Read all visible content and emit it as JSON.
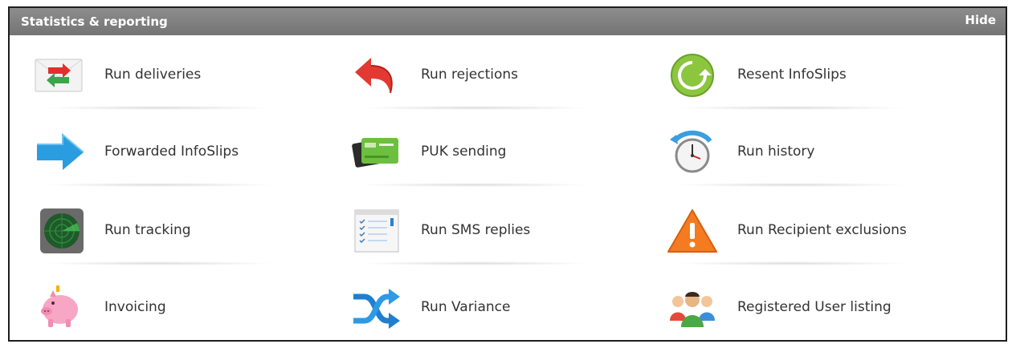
{
  "panel": {
    "title": "Statistics & reporting",
    "hide_label": "Hide"
  },
  "items": [
    {
      "label": "Run deliveries",
      "icon": "envelope-exchange-icon"
    },
    {
      "label": "Run rejections",
      "icon": "undo-arrow-icon"
    },
    {
      "label": "Resent InfoSlips",
      "icon": "refresh-circle-icon"
    },
    {
      "label": "Forwarded InfoSlips",
      "icon": "forward-arrow-icon"
    },
    {
      "label": "PUK sending",
      "icon": "credit-card-icon"
    },
    {
      "label": "Run history",
      "icon": "clock-history-icon"
    },
    {
      "label": "Run tracking",
      "icon": "radar-icon"
    },
    {
      "label": "Run SMS replies",
      "icon": "checklist-icon"
    },
    {
      "label": "Run Recipient exclusions",
      "icon": "warning-icon"
    },
    {
      "label": "Invoicing",
      "icon": "piggy-bank-icon"
    },
    {
      "label": "Run Variance",
      "icon": "shuffle-icon"
    },
    {
      "label": "Registered User listing",
      "icon": "users-group-icon"
    }
  ]
}
